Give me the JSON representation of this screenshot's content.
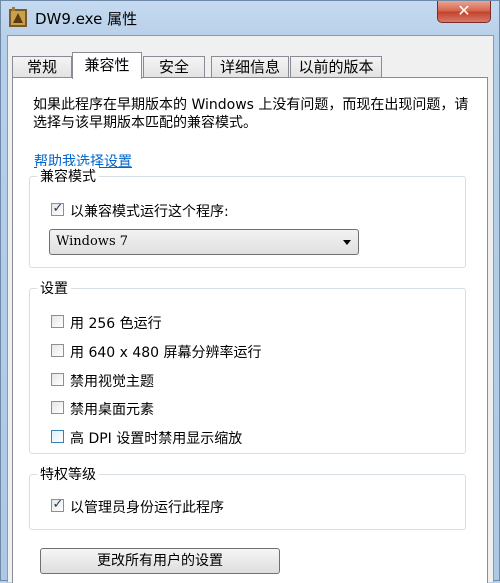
{
  "window": {
    "title": "DW9.exe 属性",
    "close_label": "✕"
  },
  "tabs": [
    {
      "label": "常规",
      "active": false
    },
    {
      "label": "兼容性",
      "active": true
    },
    {
      "label": "安全",
      "active": false
    },
    {
      "label": "详细信息",
      "active": false
    },
    {
      "label": "以前的版本",
      "active": false
    }
  ],
  "intro": {
    "text": "如果此程序在早期版本的 Windows 上没有问题，而现在出现问题，请选择与该早期版本匹配的兼容模式。",
    "help_link": "帮助我选择设置"
  },
  "compat_mode": {
    "title": "兼容模式",
    "checkbox_label": "以兼容模式运行这个程序:",
    "checked": true,
    "selected_os": "Windows 7"
  },
  "settings": {
    "title": "设置",
    "items": [
      {
        "label": "用 256 色运行",
        "checked": false
      },
      {
        "label": "用 640 x 480 屏幕分辨率运行",
        "checked": false
      },
      {
        "label": "禁用视觉主题",
        "checked": false
      },
      {
        "label": "禁用桌面元素",
        "checked": false
      },
      {
        "label": "高 DPI 设置时禁用显示缩放",
        "checked": false
      }
    ]
  },
  "privilege": {
    "title": "特权等级",
    "checkbox_label": "以管理员身份运行此程序",
    "checked": true
  },
  "all_users_button": "更改所有用户的设置",
  "check_glyph": "✓"
}
